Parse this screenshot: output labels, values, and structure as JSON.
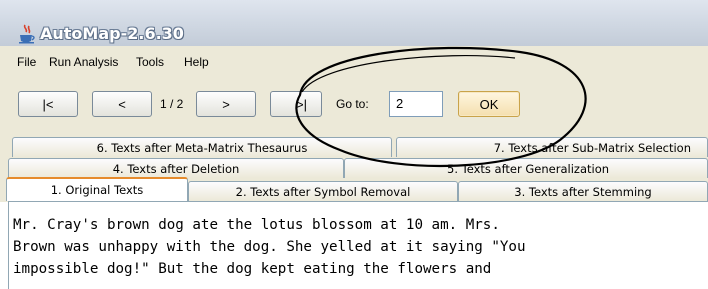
{
  "window": {
    "title": "AutoMap-2.6.30",
    "icon": "java-cup-icon"
  },
  "menu": {
    "items": [
      "File",
      "Run Analysis",
      "Tools",
      "Help"
    ]
  },
  "navigation": {
    "first_label": "|<",
    "prev_label": "<",
    "page_indicator": "1 / 2",
    "next_label": ">",
    "last_label": ">|",
    "goto_label": "Go to:",
    "goto_value": "2",
    "ok_label": "OK"
  },
  "tabs": {
    "row1": [
      "6. Texts after Meta-Matrix Thesaurus",
      "7. Texts after Sub-Matrix Selection"
    ],
    "row2": [
      "4. Texts after Deletion",
      "5. Texts after Generalization"
    ],
    "row3": [
      "1. Original Texts",
      "2. Texts after Symbol Removal",
      "3. Texts after Stemming"
    ],
    "active": "1. Original Texts"
  },
  "content": {
    "lines": [
      "Mr. Cray's brown dog ate the lotus blossom at 10 am. Mrs.",
      "Brown was unhappy with the dog. She yelled at it saying \"You",
      "impossible dog!\" But the dog kept eating the flowers and"
    ]
  }
}
